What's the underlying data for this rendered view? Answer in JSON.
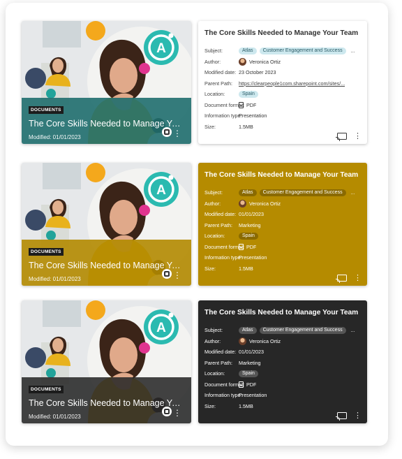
{
  "cards": [
    {
      "variant": "teal",
      "image_card": {
        "badge": "DOCUMENTS",
        "title": "The Core Skills Needed to Manage Your Team",
        "modified": "Modified: 01/01/2023"
      },
      "info_card": {
        "title": "The Core Skills Needed to Manage Your Team",
        "subject_label": "Subject:",
        "subject_tags": [
          "Atlas",
          "Customer Engagement and Success"
        ],
        "subject_more": "...",
        "author_label": "Author:",
        "author": "Veronica Ortiz",
        "modified_label": "Modified date:",
        "modified": "23 October 2023",
        "parent_label": "Parent Path:",
        "parent": "https://clearpeople1com.sharepoint.com/sites/...",
        "location_label": "Location:",
        "location": "Spain",
        "format_label": "Document format:",
        "format": "PDF",
        "info_type_label": "Information type:",
        "info_type": "Presentation",
        "size_label": "Size:",
        "size": "1.5MB"
      }
    },
    {
      "variant": "gold",
      "image_card": {
        "badge": "DOCUMENTS",
        "title": "The Core Skills Needed to Manage Your Team",
        "modified": "Modified: 01/01/2023"
      },
      "info_card": {
        "title": "The Core Skills Needed to Manage Your Team",
        "subject_label": "Subject:",
        "subject_tags": [
          "Atlas",
          "Customer Engagement and Success"
        ],
        "subject_more": "...",
        "author_label": "Author:",
        "author": "Veronica Ortiz",
        "modified_label": "Modified date:",
        "modified": "01/01/2023",
        "parent_label": "Parent Path:",
        "parent": "Marketing",
        "location_label": "Location:",
        "location": "Spain",
        "format_label": "Document format:",
        "format": "PDF",
        "info_type_label": "Information type:",
        "info_type": "Presentation",
        "size_label": "Size:",
        "size": "1.5MB"
      }
    },
    {
      "variant": "dark",
      "image_card": {
        "badge": "DOCUMENTS",
        "title": "The Core Skills Needed to Manage Your Team",
        "modified": "Modified: 01/01/2023"
      },
      "info_card": {
        "title": "The Core Skills Needed to Manage Your Team",
        "subject_label": "Subject:",
        "subject_tags": [
          "Atlas",
          "Customer Engagement and Success"
        ],
        "subject_more": "...",
        "author_label": "Author:",
        "author": "Veronica Ortiz",
        "modified_label": "Modified date:",
        "modified": "01/01/2023",
        "parent_label": "Parent Path:",
        "parent": "Marketing",
        "location_label": "Location:",
        "location": "Spain",
        "format_label": "Document format:",
        "format": "PDF",
        "info_type_label": "Information type:",
        "info_type": "Presentation",
        "size_label": "Size:",
        "size": "1.5MB"
      }
    }
  ],
  "colors": {
    "teal": "#1f6e6e",
    "gold": "#b58b00",
    "dark": "#272727",
    "orange_dot": "#f4a81c",
    "pink_dot": "#e0348f",
    "navy_dot": "#3a4a66",
    "logo_teal": "#2bbab0"
  },
  "icons": [
    "logo-a-icon",
    "share-icon",
    "more-icon",
    "cast-icon",
    "pdf-icon",
    "avatar"
  ]
}
